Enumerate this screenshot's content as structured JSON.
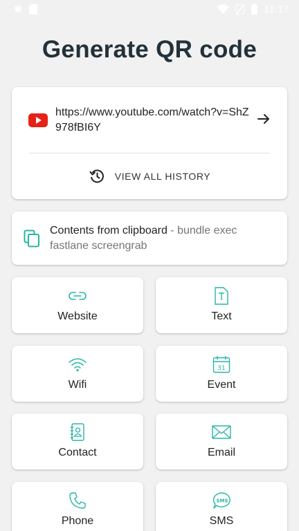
{
  "status_bar": {
    "time": "11:17",
    "icons": [
      "notification-icon",
      "sd-card-icon",
      "wifi-icon",
      "no-sim-icon",
      "battery-icon"
    ]
  },
  "title": "Generate QR code",
  "history": {
    "url": "https://www.youtube.com/watch?v=ShZ978fBI6Y",
    "source_icon": "youtube-icon",
    "view_all_label": "VIEW ALL HISTORY"
  },
  "clipboard": {
    "label": "Contents from clipboard",
    "separator": " - ",
    "content": "bundle exec fastlane screengrab"
  },
  "types": [
    {
      "label": "Website",
      "icon": "link-icon"
    },
    {
      "label": "Text",
      "icon": "text-icon"
    },
    {
      "label": "Wifi",
      "icon": "wifi-icon"
    },
    {
      "label": "Event",
      "icon": "calendar-icon"
    },
    {
      "label": "Contact",
      "icon": "contact-book-icon"
    },
    {
      "label": "Email",
      "icon": "envelope-icon"
    },
    {
      "label": "Phone",
      "icon": "phone-icon"
    },
    {
      "label": "SMS",
      "icon": "sms-icon"
    }
  ],
  "colors": {
    "accent": "#26b5a5",
    "background": "#f1f1f1",
    "title": "#23313a",
    "youtube": "#e62117"
  }
}
